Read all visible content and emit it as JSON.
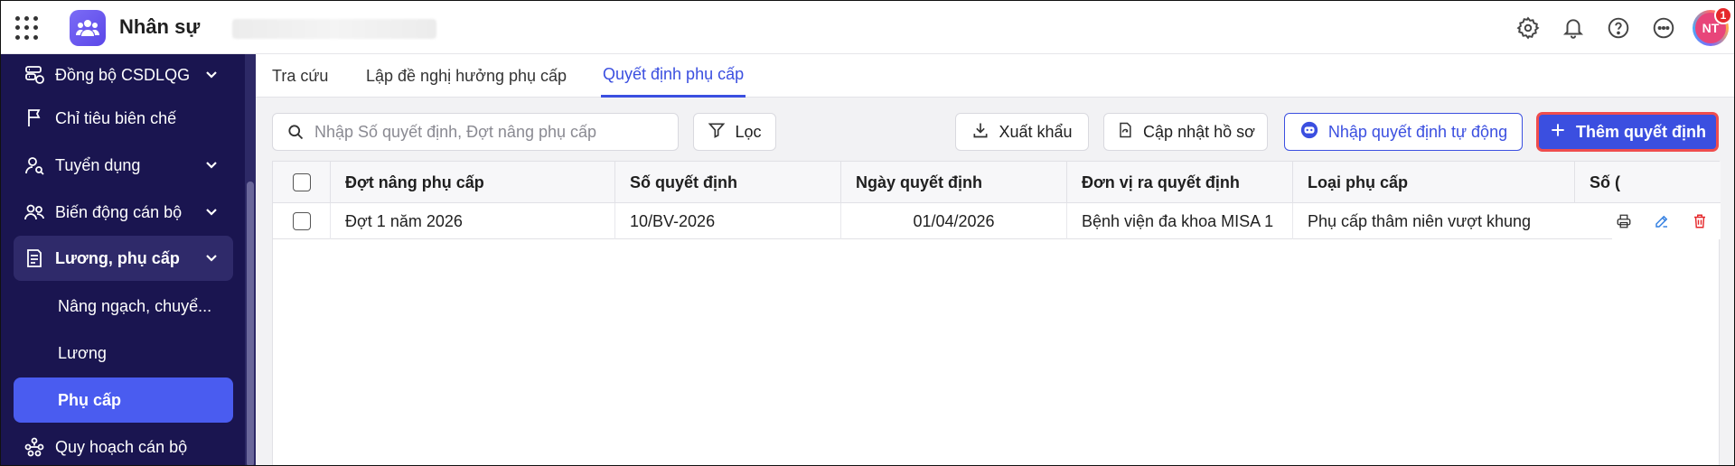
{
  "app": {
    "title": "Nhân sự"
  },
  "header": {
    "avatar_initials": "NT",
    "notification_count": "1"
  },
  "sidebar": {
    "items": [
      {
        "label": "Đồng bộ CSDLQG",
        "icon": "database-sync-icon",
        "has_chevron": true
      },
      {
        "label": "Chỉ tiêu biên chế",
        "icon": "flag-icon",
        "has_chevron": false
      },
      {
        "label": "Tuyển dụng",
        "icon": "user-search-icon",
        "has_chevron": true
      },
      {
        "label": "Biến động cán bộ",
        "icon": "users-icon",
        "has_chevron": true
      },
      {
        "label": "Lương, phụ cấp",
        "icon": "document-money-icon",
        "has_chevron": true,
        "expanded": true
      }
    ],
    "subitems": [
      {
        "label": "Nâng ngạch, chuyể..."
      },
      {
        "label": "Lương"
      },
      {
        "label": "Phụ cấp",
        "active": true
      }
    ],
    "last_item": {
      "label": "Quy hoạch cán bộ",
      "icon": "org-chart-icon"
    }
  },
  "tabs": [
    {
      "label": "Tra cứu"
    },
    {
      "label": "Lập đề nghị hưởng phụ cấp"
    },
    {
      "label": "Quyết định phụ cấp",
      "active": true
    }
  ],
  "toolbar": {
    "search_placeholder": "Nhập Số quyết định, Đợt nâng phụ cấp",
    "filter_label": "Lọc",
    "export_label": "Xuất khẩu",
    "update_label": "Cập nhật hồ sơ",
    "auto_import_label": "Nhập quyết định tự động",
    "add_label": "Thêm quyết định"
  },
  "table": {
    "columns": [
      "Đợt nâng phụ cấp",
      "Số quyết định",
      "Ngày quyết định",
      "Đơn vị ra quyết định",
      "Loại phụ cấp",
      "Số ("
    ],
    "rows": [
      {
        "dot": "Đợt 1 năm 2026",
        "so_qd": "10/BV-2026",
        "ngay": "01/04/2026",
        "don_vi": "Bệnh viện đa khoa MISA 1",
        "loai": "Phụ cấp thâm niên vượt khung"
      }
    ]
  },
  "colors": {
    "sidebar_bg": "#1a1550",
    "accent": "#3b4fe0",
    "danger": "#e5282b"
  }
}
